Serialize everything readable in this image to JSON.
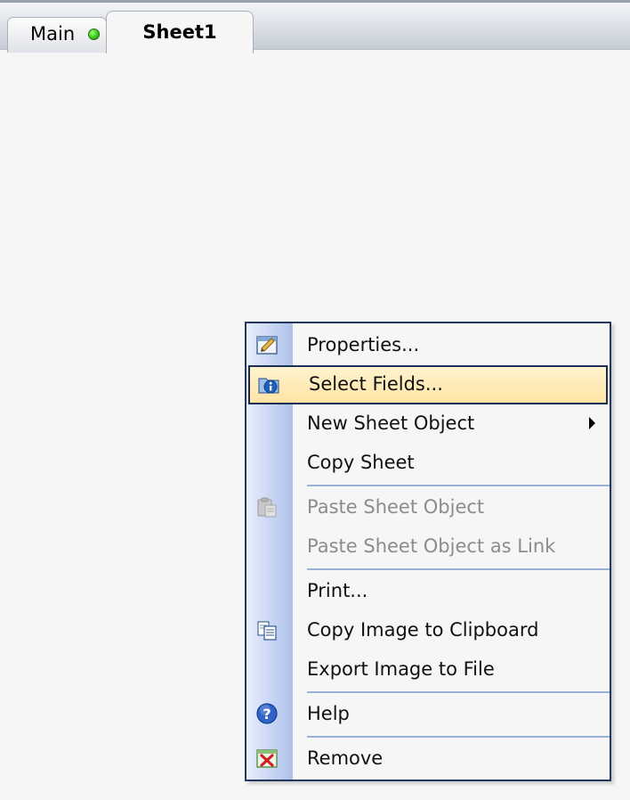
{
  "tabs": {
    "main_label": "Main",
    "sheet_label": "Sheet1",
    "main_status_color": "#3fcf1c"
  },
  "menu": {
    "items": [
      {
        "label": "Properties...",
        "icon": "properties-icon",
        "enabled": true
      },
      {
        "label": "Select Fields...",
        "icon": "select-fields-icon",
        "enabled": true,
        "highlighted": true
      },
      {
        "label": "New Sheet Object",
        "icon": "",
        "enabled": true,
        "submenu": true
      },
      {
        "label": "Copy Sheet",
        "icon": "",
        "enabled": true
      },
      {
        "label": "Paste Sheet Object",
        "icon": "paste-icon",
        "enabled": false
      },
      {
        "label": "Paste Sheet Object as Link",
        "icon": "",
        "enabled": false
      },
      {
        "label": "Print...",
        "icon": "",
        "enabled": true
      },
      {
        "label": "Copy Image to Clipboard",
        "icon": "copy-icon",
        "enabled": true
      },
      {
        "label": "Export Image to File",
        "icon": "",
        "enabled": true
      },
      {
        "label": "Help",
        "icon": "help-icon",
        "enabled": true
      },
      {
        "label": "Remove",
        "icon": "remove-icon",
        "enabled": true
      }
    ]
  },
  "colors": {
    "highlight": "#ffe3a3",
    "menu_border": "#22385f",
    "disabled_text": "#8c8c8c"
  }
}
